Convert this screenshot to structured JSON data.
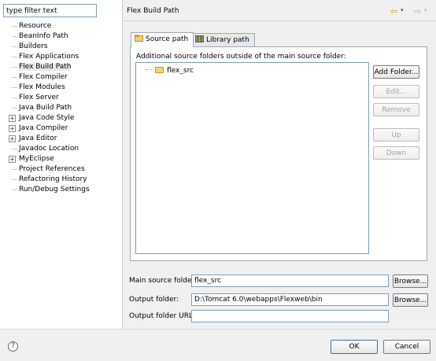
{
  "filter": {
    "value": "type filter text"
  },
  "tree": {
    "items": [
      {
        "label": "Resource",
        "expandable": false
      },
      {
        "label": "BeanInfo Path",
        "expandable": false
      },
      {
        "label": "Builders",
        "expandable": false
      },
      {
        "label": "Flex Applications",
        "expandable": false
      },
      {
        "label": "Flex Build Path",
        "expandable": false,
        "selected": true
      },
      {
        "label": "Flex Compiler",
        "expandable": false
      },
      {
        "label": "Flex Modules",
        "expandable": false
      },
      {
        "label": "Flex Server",
        "expandable": false
      },
      {
        "label": "Java Build Path",
        "expandable": false
      },
      {
        "label": "Java Code Style",
        "expandable": true
      },
      {
        "label": "Java Compiler",
        "expandable": true
      },
      {
        "label": "Java Editor",
        "expandable": true
      },
      {
        "label": "Javadoc Location",
        "expandable": false
      },
      {
        "label": "MyEclipse",
        "expandable": true
      },
      {
        "label": "Project References",
        "expandable": false
      },
      {
        "label": "Refactoring History",
        "expandable": false
      },
      {
        "label": "Run/Debug Settings",
        "expandable": false
      }
    ],
    "expander_glyph": "+"
  },
  "header": {
    "title": "Flex Build Path",
    "back_icon": "arrow-left-icon",
    "forward_icon": "arrow-right-icon",
    "back_glyph": "⇦",
    "forward_glyph": "⇨",
    "dropdown_glyph": "▾"
  },
  "tabs": {
    "source": "Source path",
    "library": "Library path"
  },
  "panel": {
    "description": "Additional source folders outside of the main source folder:",
    "folder": "flex_src"
  },
  "buttons": {
    "add_folder": "Add Folder...",
    "edit": "Edit...",
    "remove": "Remove",
    "up": "Up",
    "down": "Down",
    "browse": "Browse...",
    "ok": "OK",
    "cancel": "Cancel"
  },
  "form": {
    "main_source_label": "Main source folder:",
    "main_source_value": "flex_src",
    "output_label": "Output folder:",
    "output_value": "D:\\Tomcat 6.0\\webapps\\Flexweb\\bin",
    "output_url_label": "Output folder URL:",
    "output_url_value": ""
  },
  "help": {
    "glyph": "?"
  },
  "colors": {
    "folder_fill": "#f3d27a",
    "back_arrow": "#d09a10",
    "accent_border": "#3a6ea5"
  }
}
